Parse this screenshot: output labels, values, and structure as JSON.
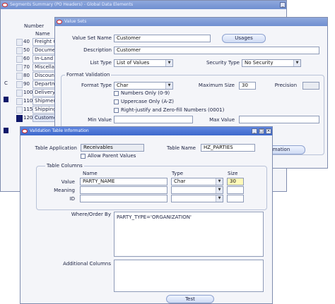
{
  "segments_window": {
    "title": "Segments Summary (PO Headers) - Global Data Elements",
    "number_header": "Number",
    "name_header": "Name",
    "rows": [
      {
        "number": "40",
        "name": "Freight Ch"
      },
      {
        "number": "50",
        "name": "Document"
      },
      {
        "number": "60",
        "name": "In-Land Fre"
      },
      {
        "number": "70",
        "name": "Miscellane"
      },
      {
        "number": "80",
        "name": "Discount"
      },
      {
        "number": "90",
        "name": "Departmen"
      },
      {
        "number": "100",
        "name": "Delivery T"
      },
      {
        "number": "110",
        "name": "Shipment"
      },
      {
        "number": "115",
        "name": "Shipping/D"
      },
      {
        "number": "120",
        "name": "Customer"
      }
    ],
    "side_letter": "C"
  },
  "value_sets_window": {
    "title": "Value Sets",
    "value_set_name_label": "Value Set Name",
    "value_set_name": "Customer",
    "usages_button": "Usages",
    "description_label": "Description",
    "description": "Customer",
    "list_type_label": "List Type",
    "list_type": "List of Values",
    "security_type_label": "Security Type",
    "security_type": "No Security",
    "format_validation_title": "Format Validation",
    "format_type_label": "Format Type",
    "format_type": "Char",
    "maximum_size_label": "Maximum Size",
    "maximum_size": "30",
    "precision_label": "Precision",
    "numbers_only": "Numbers Only (0-9)",
    "uppercase_only": "Uppercase Only (A-Z)",
    "right_justify": "Right-justify and Zero-fill Numbers (0001)",
    "min_value_label": "Min Value",
    "max_value_label": "Max Value",
    "edit_info_button": "mation"
  },
  "validation_window": {
    "title": "Validation Table Information",
    "table_application_label": "Table Application",
    "table_application": "Receivables",
    "table_name_label": "Table Name",
    "table_name": "HZ_PARTIES",
    "allow_parent_values": "Allow Parent Values",
    "table_columns_title": "Table Columns",
    "col_name_header": "Name",
    "col_type_header": "Type",
    "col_size_header": "Size",
    "value_label": "Value",
    "value_name": "PARTY_NAME",
    "value_type": "Char",
    "value_size": "30",
    "meaning_label": "Meaning",
    "id_label": "ID",
    "where_order_by_label": "Where/Order By",
    "where_order_by": "PARTY_TYPE='ORGANIZATION'",
    "additional_columns_label": "Additional Columns",
    "test_button": "Test"
  },
  "colors": {
    "title_active": "#3d68cc",
    "title_inactive": "#8fa8dd",
    "window_bg": "#f4f5f9",
    "field_yellow": "#fff9b8"
  }
}
